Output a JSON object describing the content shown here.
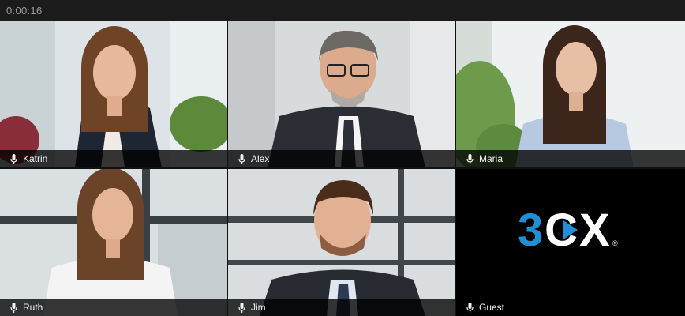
{
  "call": {
    "timer": "0:00:16"
  },
  "participants": [
    {
      "name": "Katrin"
    },
    {
      "name": "Alex"
    },
    {
      "name": "Maria"
    },
    {
      "name": "Ruth"
    },
    {
      "name": "Jim"
    },
    {
      "name": "Guest"
    }
  ],
  "logo": {
    "mark": "3CX",
    "registered": "®"
  },
  "colors": {
    "logo_blue": "#1f8fd6",
    "logo_white": "#ffffff",
    "label_bg": "#000000",
    "topbar": "#1b1b1b"
  },
  "icons": {
    "mic": "microphone-icon"
  }
}
